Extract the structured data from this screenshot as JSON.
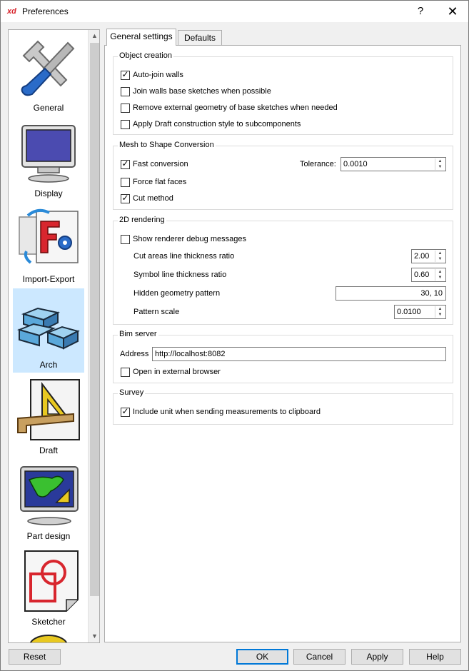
{
  "window": {
    "app_logo": "xd",
    "title": "Preferences",
    "help_glyph": "?",
    "close_glyph": "✕"
  },
  "sidebar": {
    "items": [
      {
        "label": "General",
        "icon": "wrench-screwdriver-icon"
      },
      {
        "label": "Display",
        "icon": "monitor-icon"
      },
      {
        "label": "Import-Export",
        "icon": "import-export-icon"
      },
      {
        "label": "Arch",
        "icon": "bricks-icon",
        "selected": true
      },
      {
        "label": "Draft",
        "icon": "draft-triangle-icon"
      },
      {
        "label": "Part design",
        "icon": "part-design-icon"
      },
      {
        "label": "Sketcher",
        "icon": "sketcher-icon"
      }
    ],
    "scroll_up": "▲",
    "scroll_down": "▼"
  },
  "tabs": [
    {
      "label": "General settings",
      "active": true
    },
    {
      "label": "Defaults",
      "active": false
    }
  ],
  "object_creation": {
    "title": "Object creation",
    "auto_join": {
      "label": "Auto-join walls",
      "checked": true
    },
    "join_base": {
      "label": "Join walls base sketches when possible",
      "checked": false
    },
    "remove_external": {
      "label": "Remove external geometry of base sketches when needed",
      "checked": false
    },
    "apply_draft": {
      "label": "Apply Draft construction style to subcomponents",
      "checked": false
    }
  },
  "mesh": {
    "title": "Mesh to Shape Conversion",
    "fast_conversion": {
      "label": "Fast conversion",
      "checked": true
    },
    "tolerance_label": "Tolerance:",
    "tolerance_value": "0.0010",
    "force_flat": {
      "label": "Force flat faces",
      "checked": false
    },
    "cut_method": {
      "label": "Cut method",
      "checked": true
    }
  },
  "rendering": {
    "title": "2D rendering",
    "debug": {
      "label": "Show renderer debug messages",
      "checked": false
    },
    "cut_ratio_label": "Cut areas line thickness ratio",
    "cut_ratio_value": "2.00",
    "symbol_ratio_label": "Symbol line thickness ratio",
    "symbol_ratio_value": "0.60",
    "hidden_pattern_label": "Hidden geometry pattern",
    "hidden_pattern_value": "30, 10",
    "pattern_scale_label": "Pattern scale",
    "pattern_scale_value": "0.0100"
  },
  "bim": {
    "title": "Bim server",
    "address_label": "Address",
    "address_value": "http://localhost:8082",
    "external_browser": {
      "label": "Open in external browser",
      "checked": false
    }
  },
  "survey": {
    "title": "Survey",
    "include_unit": {
      "label": "Include unit when sending measurements to clipboard",
      "checked": true
    }
  },
  "buttons": {
    "reset": "Reset",
    "ok": "OK",
    "cancel": "Cancel",
    "apply": "Apply",
    "help": "Help"
  },
  "check_glyph": "✓",
  "spin_up_glyph": "▲",
  "spin_down_glyph": "▼"
}
